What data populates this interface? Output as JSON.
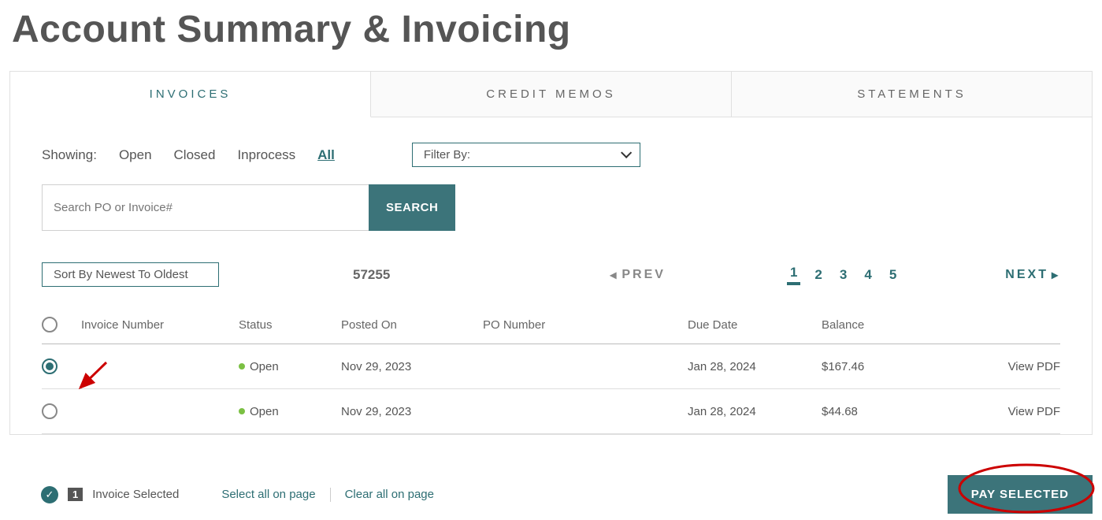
{
  "page": {
    "title": "Account Summary & Invoicing"
  },
  "tabs": {
    "invoices": "INVOICES",
    "credit_memos": "CREDIT MEMOS",
    "statements": "STATEMENTS"
  },
  "filters": {
    "showing_label": "Showing:",
    "open": "Open",
    "closed": "Closed",
    "inprocess": "Inprocess",
    "all": "All",
    "filter_by_label": "Filter By:"
  },
  "search": {
    "placeholder": "Search PO or Invoice#",
    "button": "SEARCH"
  },
  "sort": {
    "label": "Sort By Newest To Oldest"
  },
  "total_count": "57255",
  "pagination": {
    "prev": "PREV",
    "next": "NEXT",
    "pages": [
      "1",
      "2",
      "3",
      "4",
      "5"
    ]
  },
  "headers": {
    "invoice_number": "Invoice Number",
    "status": "Status",
    "posted_on": "Posted On",
    "po_number": "PO Number",
    "due_date": "Due Date",
    "balance": "Balance"
  },
  "rows": [
    {
      "selected": true,
      "status": "Open",
      "status_color": "#7bc043",
      "posted_on": "Nov 29, 2023",
      "due_date": "Jan 28, 2024",
      "balance": "$167.46",
      "view": "View PDF"
    },
    {
      "selected": false,
      "status": "Open",
      "status_color": "#7bc043",
      "posted_on": "Nov 29, 2023",
      "due_date": "Jan 28, 2024",
      "balance": "$44.68",
      "view": "View PDF"
    }
  ],
  "footer": {
    "count": "1",
    "selected_label": "Invoice Selected",
    "select_all": "Select all on page",
    "clear_all": "Clear all on page",
    "pay_button": "PAY SELECTED"
  },
  "annotations": {
    "arrow_color": "#c00",
    "ellipse_color": "#c00"
  }
}
